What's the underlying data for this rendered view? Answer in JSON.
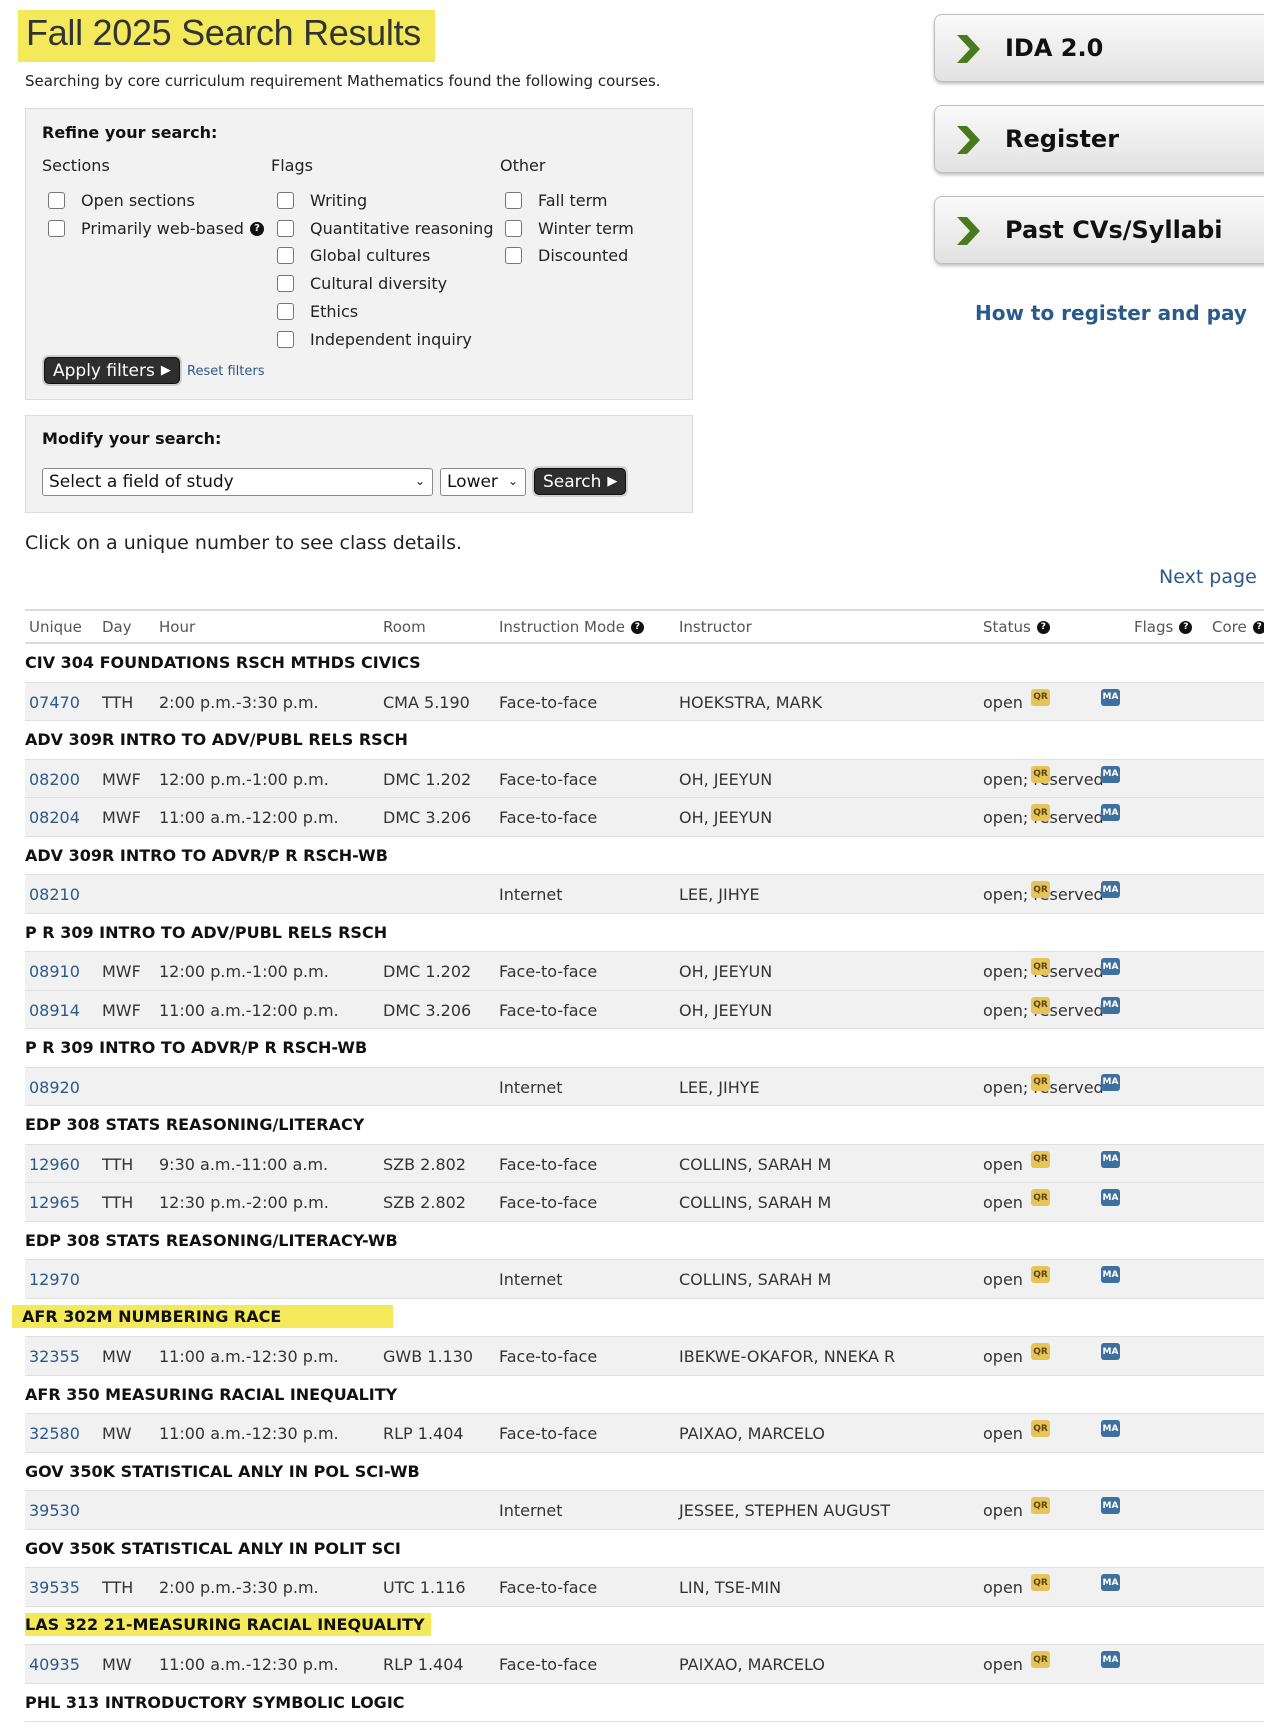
{
  "header": {
    "title": "Fall 2025 Search Results",
    "intro": "Searching by core curriculum requirement Mathematics found the following courses."
  },
  "refine": {
    "title": "Refine your search:",
    "sections_heading": "Sections",
    "flags_heading": "Flags",
    "other_heading": "Other",
    "sections": [
      "Open sections",
      "Primarily web-based"
    ],
    "flags": [
      "Writing",
      "Quantitative reasoning",
      "Global cultures",
      "Cultural diversity",
      "Ethics",
      "Independent inquiry"
    ],
    "other": [
      "Fall term",
      "Winter term",
      "Discounted"
    ],
    "apply_label": "Apply filters",
    "reset_label": "Reset filters"
  },
  "modify": {
    "title": "Modify your search:",
    "field_select": "Select a field of study",
    "level_select": "Lower",
    "search_label": "Search"
  },
  "click_note": "Click on a unique number to see class details.",
  "next_page": "Next page",
  "sidebar": {
    "buttons": [
      "IDA 2.0",
      "Register",
      "Past CVs/Syllabi"
    ],
    "how_link": "How to register and pay",
    "arrow_color": "#4a7a1e"
  },
  "table": {
    "headers": {
      "unique": "Unique",
      "day": "Day",
      "hour": "Hour",
      "room": "Room",
      "mode": "Instruction Mode",
      "instructor": "Instructor",
      "status": "Status",
      "flags": "Flags",
      "core": "Core"
    },
    "flag_icon": "QR",
    "core_icon": "MA",
    "courses": [
      {
        "title": "CIV 304 FOUNDATIONS RSCH MTHDS CIVICS",
        "highlight": false,
        "sections": [
          {
            "unique": "07470",
            "day": "TTH",
            "hour": "2:00 p.m.-3:30 p.m.",
            "room": "CMA 5.190",
            "mode": "Face-to-face",
            "instructor": "HOEKSTRA, MARK",
            "status": "open"
          }
        ]
      },
      {
        "title": "ADV 309R INTRO TO ADV/PUBL RELS RSCH",
        "highlight": false,
        "sections": [
          {
            "unique": "08200",
            "day": "MWF",
            "hour": "12:00 p.m.-1:00 p.m.",
            "room": "DMC 1.202",
            "mode": "Face-to-face",
            "instructor": "OH, JEEYUN",
            "status": "open; reserved"
          },
          {
            "unique": "08204",
            "day": "MWF",
            "hour": "11:00 a.m.-12:00 p.m.",
            "room": "DMC 3.206",
            "mode": "Face-to-face",
            "instructor": "OH, JEEYUN",
            "status": "open; reserved"
          }
        ]
      },
      {
        "title": "ADV 309R INTRO TO ADVR/P R RSCH-WB",
        "highlight": false,
        "sections": [
          {
            "unique": "08210",
            "day": "",
            "hour": "",
            "room": "",
            "mode": "Internet",
            "instructor": "LEE, JIHYE",
            "status": "open; reserved"
          }
        ]
      },
      {
        "title": "P R 309 INTRO TO ADV/PUBL RELS RSCH",
        "highlight": false,
        "sections": [
          {
            "unique": "08910",
            "day": "MWF",
            "hour": "12:00 p.m.-1:00 p.m.",
            "room": "DMC 1.202",
            "mode": "Face-to-face",
            "instructor": "OH, JEEYUN",
            "status": "open; reserved"
          },
          {
            "unique": "08914",
            "day": "MWF",
            "hour": "11:00 a.m.-12:00 p.m.",
            "room": "DMC 3.206",
            "mode": "Face-to-face",
            "instructor": "OH, JEEYUN",
            "status": "open; reserved"
          }
        ]
      },
      {
        "title": "P R 309 INTRO TO ADVR/P R RSCH-WB",
        "highlight": false,
        "sections": [
          {
            "unique": "08920",
            "day": "",
            "hour": "",
            "room": "",
            "mode": "Internet",
            "instructor": "LEE, JIHYE",
            "status": "open; reserved"
          }
        ]
      },
      {
        "title": "EDP 308 STATS REASONING/LITERACY",
        "highlight": false,
        "sections": [
          {
            "unique": "12960",
            "day": "TTH",
            "hour": "9:30 a.m.-11:00 a.m.",
            "room": "SZB 2.802",
            "mode": "Face-to-face",
            "instructor": "COLLINS, SARAH M",
            "status": "open"
          },
          {
            "unique": "12965",
            "day": "TTH",
            "hour": "12:30 p.m.-2:00 p.m.",
            "room": "SZB 2.802",
            "mode": "Face-to-face",
            "instructor": "COLLINS, SARAH M",
            "status": "open"
          }
        ]
      },
      {
        "title": "EDP 308 STATS REASONING/LITERACY-WB",
        "highlight": false,
        "sections": [
          {
            "unique": "12970",
            "day": "",
            "hour": "",
            "room": "",
            "mode": "Internet",
            "instructor": "COLLINS, SARAH M",
            "status": "open"
          }
        ]
      },
      {
        "title": "AFR 302M NUMBERING RACE",
        "highlight": true,
        "sections": [
          {
            "unique": "32355",
            "day": "MW",
            "hour": "11:00 a.m.-12:30 p.m.",
            "room": "GWB 1.130",
            "mode": "Face-to-face",
            "instructor": "IBEKWE-OKAFOR, NNEKA R",
            "status": "open"
          }
        ]
      },
      {
        "title": "AFR 350 MEASURING RACIAL INEQUALITY",
        "highlight": false,
        "sections": [
          {
            "unique": "32580",
            "day": "MW",
            "hour": "11:00 a.m.-12:30 p.m.",
            "room": "RLP 1.404",
            "mode": "Face-to-face",
            "instructor": "PAIXAO, MARCELO",
            "status": "open"
          }
        ]
      },
      {
        "title": "GOV 350K STATISTICAL ANLY IN POL SCI-WB",
        "highlight": false,
        "sections": [
          {
            "unique": "39530",
            "day": "",
            "hour": "",
            "room": "",
            "mode": "Internet",
            "instructor": "JESSEE, STEPHEN AUGUST",
            "status": "open"
          }
        ]
      },
      {
        "title": "GOV 350K STATISTICAL ANLY IN POLIT SCI",
        "highlight": false,
        "sections": [
          {
            "unique": "39535",
            "day": "TTH",
            "hour": "2:00 p.m.-3:30 p.m.",
            "room": "UTC 1.116",
            "mode": "Face-to-face",
            "instructor": "LIN, TSE-MIN",
            "status": "open"
          }
        ]
      },
      {
        "title": "LAS 322 21-MEASURING RACIAL INEQUALITY",
        "highlight": true,
        "sections": [
          {
            "unique": "40935",
            "day": "MW",
            "hour": "11:00 a.m.-12:30 p.m.",
            "room": "RLP 1.404",
            "mode": "Face-to-face",
            "instructor": "PAIXAO, MARCELO",
            "status": "open"
          }
        ]
      },
      {
        "title": "PHL 313 INTRODUCTORY SYMBOLIC LOGIC",
        "highlight": false,
        "sections": []
      }
    ]
  }
}
